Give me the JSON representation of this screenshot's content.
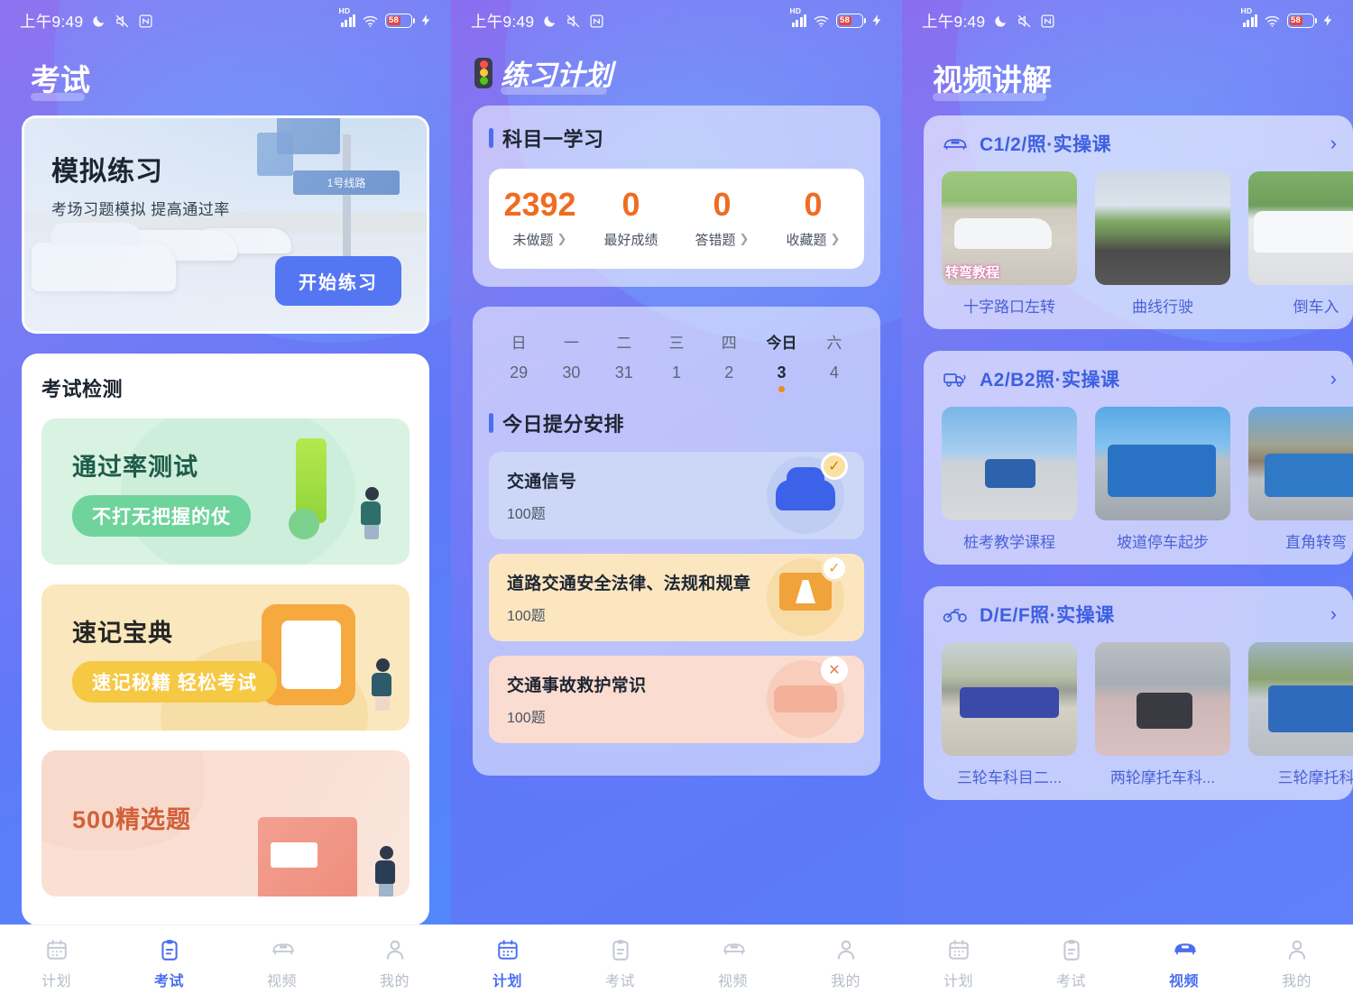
{
  "status_bar": {
    "time": "上午9:49",
    "icons_left": [
      "moon-icon",
      "mute-icon",
      "nfc-icon"
    ],
    "hd_label": "HD",
    "battery_percent": "58",
    "icons_right": [
      "signal-icon",
      "wifi-icon",
      "battery-icon",
      "charging-icon"
    ]
  },
  "screen_exam": {
    "title": "考试",
    "banner": {
      "heading": "模拟练习",
      "subheading": "考场习题模拟 提高通过率",
      "button": "开始练习",
      "sign_text": "1号线路"
    },
    "section": {
      "title": "考试检测",
      "cards": [
        {
          "title": "通过率测试",
          "pill": "不打无把握的仗",
          "theme": "green"
        },
        {
          "title": "速记宝典",
          "pill": "速记秘籍 轻松考试",
          "theme": "yellow"
        },
        {
          "title": "500精选题",
          "pill": "",
          "theme": "pink"
        }
      ]
    },
    "tabs": [
      {
        "label": "计划",
        "icon": "calendar-icon",
        "active": false
      },
      {
        "label": "考试",
        "icon": "clipboard-icon",
        "active": true
      },
      {
        "label": "视频",
        "icon": "car-icon",
        "active": false
      },
      {
        "label": "我的",
        "icon": "person-icon",
        "active": false
      }
    ]
  },
  "screen_plan": {
    "title": "练习计划",
    "title_icon": "traffic-light-icon",
    "study_card": {
      "title": "科目一学习",
      "stats": [
        {
          "value": "2392",
          "label": "未做题",
          "has_chevron": true
        },
        {
          "value": "0",
          "label": "最好成绩",
          "has_chevron": false
        },
        {
          "value": "0",
          "label": "答错题",
          "has_chevron": true
        },
        {
          "value": "0",
          "label": "收藏题",
          "has_chevron": true
        }
      ]
    },
    "calendar": [
      {
        "weekday": "日",
        "day": "29",
        "today": false
      },
      {
        "weekday": "一",
        "day": "30",
        "today": false
      },
      {
        "weekday": "二",
        "day": "31",
        "today": false
      },
      {
        "weekday": "三",
        "day": "1",
        "today": false
      },
      {
        "weekday": "四",
        "day": "2",
        "today": false
      },
      {
        "weekday": "今日",
        "day": "3",
        "today": true
      },
      {
        "weekday": "六",
        "day": "4",
        "today": false
      }
    ],
    "schedule_title": "今日提分安排",
    "tasks": [
      {
        "name": "交通信号",
        "count": "100题",
        "theme": "blue",
        "badge": "check",
        "icon": "car-icon"
      },
      {
        "name": "道路交通安全法律、法规和规章",
        "count": "100题",
        "theme": "yellow",
        "badge": "check",
        "icon": "road-board-icon"
      },
      {
        "name": "交通事故救护常识",
        "count": "100题",
        "theme": "pink",
        "badge": "cross",
        "icon": "crash-icon"
      }
    ],
    "tabs": [
      {
        "label": "计划",
        "icon": "calendar-icon",
        "active": true
      },
      {
        "label": "考试",
        "icon": "clipboard-icon",
        "active": false
      },
      {
        "label": "视频",
        "icon": "car-icon",
        "active": false
      },
      {
        "label": "我的",
        "icon": "person-icon",
        "active": false
      }
    ]
  },
  "screen_video": {
    "title": "视频讲解",
    "sections": [
      {
        "name": "C1/2/照·实操课",
        "icon": "car-icon",
        "arrow": "›",
        "videos": [
          {
            "caption": "十字路口左转",
            "overlay": "转弯教程"
          },
          {
            "caption": "曲线行驶",
            "overlay": ""
          },
          {
            "caption": "倒车入",
            "overlay": ""
          }
        ]
      },
      {
        "name": "A2/B2照·实操课",
        "icon": "truck-icon",
        "arrow": "›",
        "videos": [
          {
            "caption": "桩考教学课程",
            "overlay": ""
          },
          {
            "caption": "坡道停车起步",
            "overlay": ""
          },
          {
            "caption": "直角转弯",
            "overlay": ""
          }
        ]
      },
      {
        "name": "D/E/F照·实操课",
        "icon": "motorcycle-icon",
        "arrow": "›",
        "videos": [
          {
            "caption": "三轮车科目二...",
            "overlay": ""
          },
          {
            "caption": "两轮摩托车科...",
            "overlay": ""
          },
          {
            "caption": "三轮摩托科",
            "overlay": ""
          }
        ]
      }
    ],
    "tabs": [
      {
        "label": "计划",
        "icon": "calendar-icon",
        "active": false
      },
      {
        "label": "考试",
        "icon": "clipboard-icon",
        "active": false
      },
      {
        "label": "视频",
        "icon": "car-icon",
        "active": true
      },
      {
        "label": "我的",
        "icon": "person-icon",
        "active": false
      }
    ]
  },
  "colors": {
    "brand_blue": "#4b6ef0",
    "accent_orange": "#ef6c22",
    "bg_gradient_start": "#8a6ef0",
    "bg_gradient_end": "#5f82fa",
    "link_blue": "#4a62d6"
  }
}
